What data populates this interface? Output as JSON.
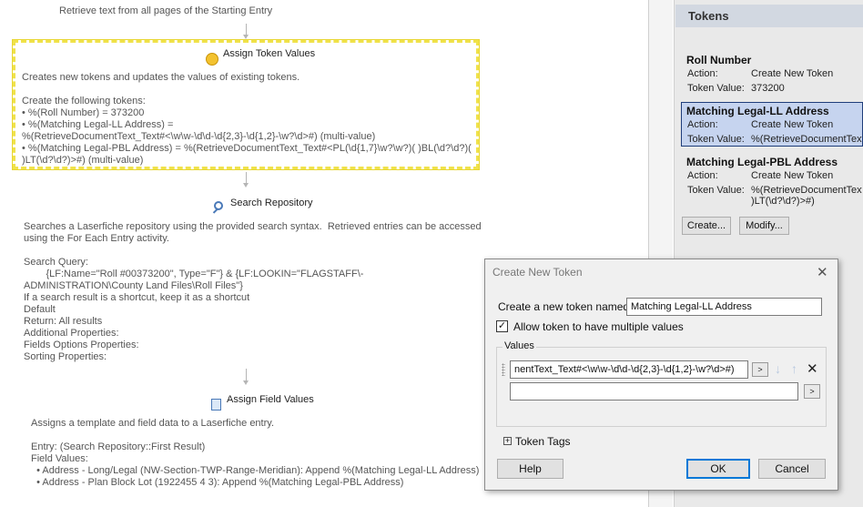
{
  "workflow": {
    "top_text": "Retrieve text from all pages of the Starting Entry",
    "assign_token": {
      "title": "Assign Token\nValues",
      "desc": "Creates new tokens and updates the values of existing tokens.",
      "lines": [
        "Create the following tokens:",
        "• %(Roll Number) = 373200",
        "• %(Matching Legal-LL Address) =",
        "%(RetrieveDocumentText_Text#<\\w\\w-\\d\\d-\\d{2,3}-\\d{1,2}-\\w?\\d>#) (multi-value)",
        "• %(Matching Legal-PBL Address) = %(RetrieveDocumentText_Text#<PL(\\d{1,7}\\w?\\w?)( )BL(\\d?\\d?)(",
        ")LT(\\d?\\d?)>#) (multi-value)"
      ]
    },
    "search": {
      "title": "Search\nRepository",
      "lines": [
        "Searches a Laserfiche repository using the provided search syntax.  Retrieved entries can be accessed",
        "using the For Each Entry activity.",
        "",
        "Search Query:",
        "        {LF:Name=\"Roll #00373200\", Type=\"F\"} & {LF:LOOKIN=\"FLAGSTAFF\\-",
        "ADMINISTRATION\\County Land Files\\Roll Files\"}",
        "If a search result is a shortcut, keep it as a shortcut",
        "Default",
        "Return: All results",
        "Additional Properties:",
        "Fields Options Properties:",
        "Sorting Properties:"
      ]
    },
    "assign_field": {
      "title": "Assign Field\nValues",
      "lines": [
        "Assigns a template and field data to a Laserfiche entry.",
        "",
        "Entry: (Search Repository::First Result)",
        "Field Values:",
        "  • Address - Long/Legal (NW-Section-TWP-Range-Meridian): Append %(Matching Legal-LL Address)",
        "  • Address - Plan Block Lot (1922455 4 3): Append %(Matching Legal-PBL Address)"
      ]
    }
  },
  "tokens_panel": {
    "header": "Tokens",
    "action_label": "Action:",
    "value_label": "Token Value:",
    "items": [
      {
        "name": "Roll Number",
        "action": "Create New Token",
        "value": "373200",
        "value2": ""
      },
      {
        "name": "Matching Legal-LL Address",
        "action": "Create New Token",
        "value": "%(RetrieveDocumentText_",
        "value2": ""
      },
      {
        "name": "Matching Legal-PBL Address",
        "action": "Create New Token",
        "value": "%(RetrieveDocumentText_",
        "value2": ")LT(\\d?\\d?)>#)"
      }
    ],
    "create_btn": "Create...",
    "modify_btn": "Modify..."
  },
  "dialog": {
    "title": "Create New Token",
    "close": "✕",
    "name_label": "Create a new token named:",
    "name_value": "Matching Legal-LL Address",
    "checkbox_label": "Allow token to have multiple values",
    "checkbox_mark": "✓",
    "values_label": "Values",
    "value_1": "nentText_Text#<\\w\\w-\\d\\d-\\d{2,3}-\\d{1,2}-\\w?\\d>#)",
    "value_2": "",
    "arrow_btn": ">",
    "down_arrow": "↓",
    "up_arrow": "↑",
    "delete": "✕",
    "token_tags": "Token Tags",
    "expand": "+",
    "help_btn": "Help",
    "ok_btn": "OK",
    "cancel_btn": "Cancel"
  },
  "colors": {
    "selection_dash": "#f0e24a",
    "token_selected_bg": "#c6d4ef",
    "panel_header_bg": "#d2d8e1",
    "ok_border": "#0078d7"
  }
}
